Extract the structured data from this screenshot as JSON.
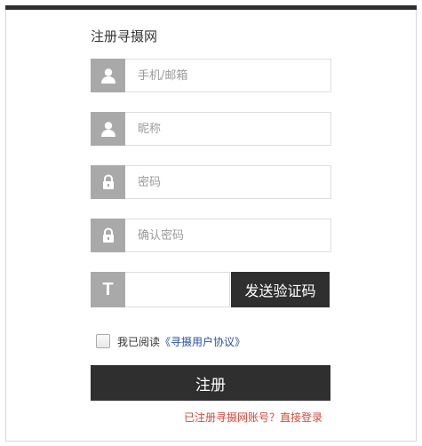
{
  "form": {
    "title": "注册寻摄网",
    "fields": {
      "account": {
        "placeholder": "手机/邮箱",
        "icon": "user-icon"
      },
      "nickname": {
        "placeholder": "昵称",
        "icon": "user-icon"
      },
      "password": {
        "placeholder": "密码",
        "icon": "lock-icon"
      },
      "confirm_password": {
        "placeholder": "确认密码",
        "icon": "lock-icon"
      },
      "verify_code": {
        "placeholder": "",
        "icon": "text-icon",
        "icon_glyph": "T"
      }
    },
    "send_code_label": "发送验证码",
    "agreement": {
      "prefix": "我已阅读",
      "link": "《寻摄用户协议》",
      "checked": false
    },
    "submit_label": "注册",
    "login_hint": "已注册寻摄网账号？直接登录"
  },
  "colors": {
    "dark": "#2f2f2f",
    "icon_bg": "#a9a9a9",
    "link": "#2a4fa5",
    "hint": "#d04a3c"
  }
}
